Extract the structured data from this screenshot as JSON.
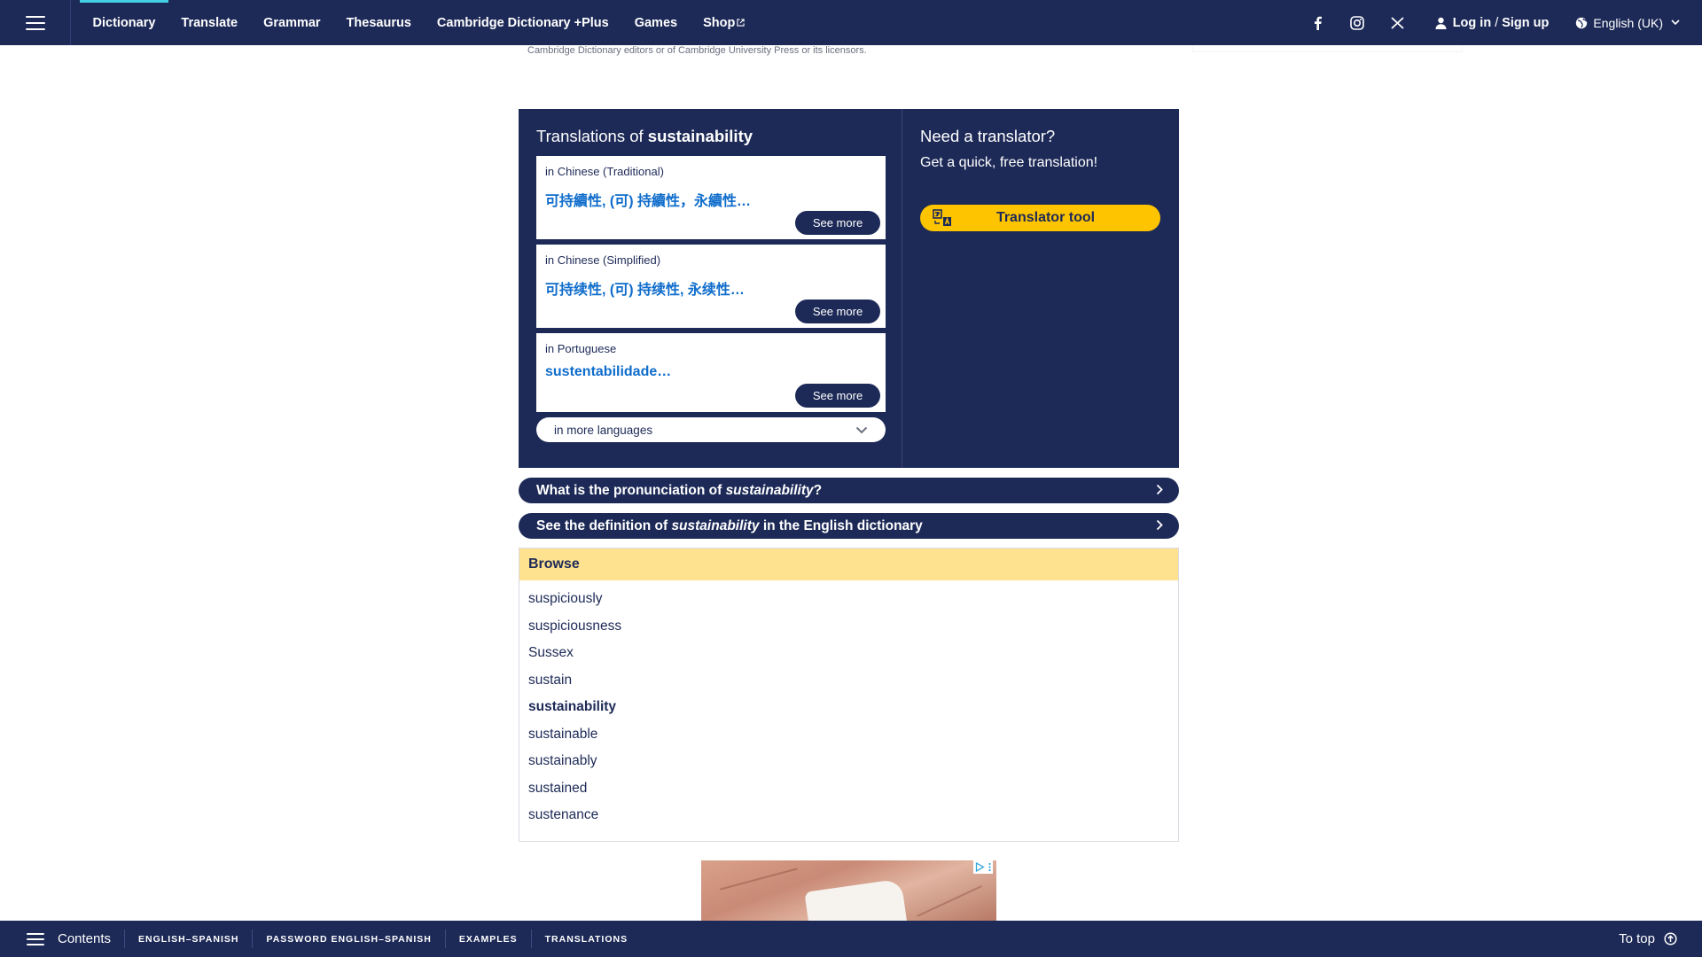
{
  "nav": {
    "items": [
      {
        "label": "Dictionary",
        "active": true
      },
      {
        "label": "Translate"
      },
      {
        "label": "Grammar"
      },
      {
        "label": "Thesaurus"
      },
      {
        "label": "Cambridge Dictionary +Plus"
      },
      {
        "label": "Games"
      },
      {
        "label": "Shop",
        "icon": "external-link-icon"
      }
    ],
    "social": [
      "facebook-icon",
      "instagram-icon",
      "x-icon"
    ],
    "login_label": "Log in",
    "login_sep": "/",
    "signup_label": "Sign up",
    "language": "English (UK)"
  },
  "copyright_fragment": "Cambridge Dictionary editors or of Cambridge University Press or its licensors.",
  "translations": {
    "title_prefix": "Translations of",
    "word": "sustainability",
    "cards": [
      {
        "language": "in Chinese (Traditional)",
        "value": "可持續性, (可) 持續性，永續性…",
        "button": "See more"
      },
      {
        "language": "in Chinese (Simplified)",
        "value": "可持续性, (可) 持续性, 永续性…",
        "button": "See more"
      },
      {
        "language": "in Portuguese",
        "value": "sustentabilidade…",
        "button": "See more"
      }
    ],
    "more_languages": "in more languages"
  },
  "translator": {
    "title": "Need a translator?",
    "subtitle": "Get a quick, free translation!",
    "button": "Translator tool"
  },
  "links": {
    "pronunciation_prefix": "What is the pronunciation of",
    "pronunciation_word": "sustainability",
    "pronunciation_suffix": "?",
    "definition_prefix": "See the definition of",
    "definition_word": "sustainability",
    "definition_suffix": "in the English dictionary"
  },
  "browse": {
    "title": "Browse",
    "items": [
      "suspiciously",
      "suspiciousness",
      "Sussex",
      "sustain",
      "sustainability",
      "sustainable",
      "sustainably",
      "sustained",
      "sustenance"
    ],
    "current": "sustainability"
  },
  "bottom": {
    "contents": "Contents",
    "tabs": [
      "ENGLISH–SPANISH",
      "PASSWORD ENGLISH–SPANISH",
      "EXAMPLES",
      "TRANSLATIONS"
    ],
    "to_top": "To top"
  },
  "colors": {
    "navy": "#1d2a57",
    "accent_cyan": "#42d0e6",
    "link_blue": "#0e6ccb",
    "yellow_button": "#fec400",
    "browse_header": "#fee28f"
  }
}
